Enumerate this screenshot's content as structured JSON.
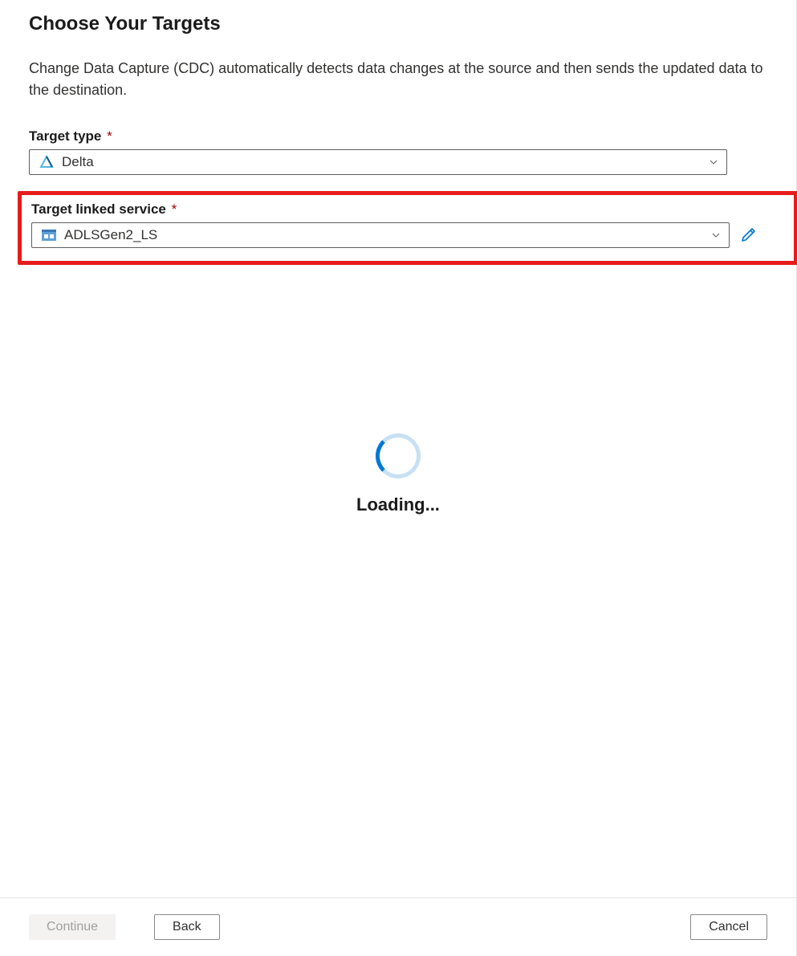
{
  "header": {
    "title": "Choose Your Targets",
    "description": "Change Data Capture (CDC) automatically detects data changes at the source and then sends the updated data to the destination."
  },
  "fields": {
    "targetType": {
      "label": "Target type",
      "value": "Delta"
    },
    "linkedService": {
      "label": "Target linked service",
      "value": "ADLSGen2_LS"
    }
  },
  "loading": {
    "text": "Loading..."
  },
  "footer": {
    "continue": "Continue",
    "back": "Back",
    "cancel": "Cancel"
  },
  "colors": {
    "highlight": "#e61c1c",
    "required": "#a80000",
    "primary": "#0078d4"
  }
}
